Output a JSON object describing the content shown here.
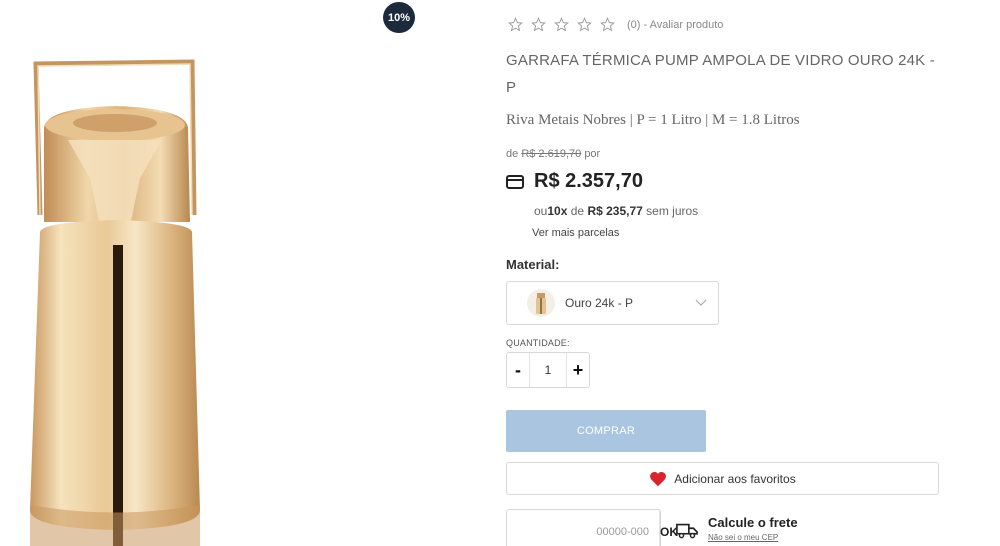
{
  "badge": {
    "discount": "10%"
  },
  "rating": {
    "stars": 0,
    "max_stars": 5,
    "text": "(0) - Avaliar produto"
  },
  "product": {
    "title": "GARRAFA TÉRMICA PUMP AMPOLA DE VIDRO OURO 24K - P",
    "subtitle": "Riva Metais Nobres | P = 1 Litro | M = 1.8 Litros"
  },
  "pricing": {
    "old_prefix": "de",
    "old_price": "R$ 2.619,70",
    "old_suffix": "por",
    "price": "R$ 2.357,70",
    "installment_prefix": "ou",
    "installment_count": "10x",
    "installment_mid": "de",
    "installment_value": "R$ 235,77",
    "installment_suffix": "sem juros",
    "more_installments": "Ver mais parcelas"
  },
  "material": {
    "label": "Material:",
    "selected": "Ouro 24k - P"
  },
  "quantity": {
    "label": "QUANTIDADE:",
    "value": "1",
    "minus": "-",
    "plus": "+"
  },
  "actions": {
    "buy": "COMPRAR",
    "favorite": "Adicionar aos favoritos"
  },
  "shipping": {
    "cep_placeholder": "00000-000",
    "ok": "OK",
    "title": "Calcule o frete",
    "subtitle": "Não sei o meu CEP"
  },
  "colors": {
    "buy_button": "#a9c5e0",
    "badge": "#1c2a3b",
    "heart": "#d9232d",
    "gold": "#d9b37a"
  },
  "icons": [
    "star-icon",
    "credit-card-icon",
    "chevron-down-icon",
    "heart-icon",
    "truck-icon"
  ]
}
